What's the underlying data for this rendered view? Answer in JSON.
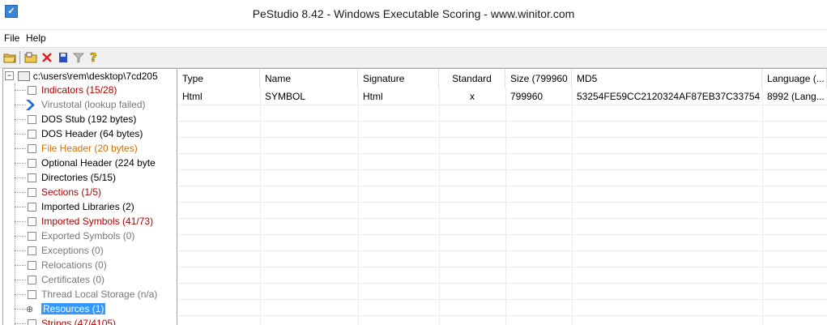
{
  "window": {
    "title": "PeStudio 8.42 - Windows Executable Scoring - www.winitor.com",
    "app_icon": "checkbox-app-icon"
  },
  "menu": [
    "File",
    "Help"
  ],
  "toolbar": {
    "buttons": [
      "open-folder-icon",
      "open-file-icon",
      "delete-icon",
      "save-icon",
      "filter-icon",
      "help-icon"
    ]
  },
  "tree": {
    "root": "c:\\users\\rem\\desktop\\7cd205",
    "items": [
      {
        "label": "Indicators (15/28)",
        "style": "red"
      },
      {
        "label": "Virustotal (lookup failed)",
        "style": "grey"
      },
      {
        "label": "DOS Stub (192 bytes)",
        "style": "normal"
      },
      {
        "label": "DOS Header (64 bytes)",
        "style": "normal"
      },
      {
        "label": "File Header (20 bytes)",
        "style": "orange"
      },
      {
        "label": "Optional Header (224 byte",
        "style": "normal"
      },
      {
        "label": "Directories (5/15)",
        "style": "normal"
      },
      {
        "label": "Sections (1/5)",
        "style": "red"
      },
      {
        "label": "Imported Libraries (2)",
        "style": "normal"
      },
      {
        "label": "Imported Symbols (41/73)",
        "style": "red"
      },
      {
        "label": "Exported Symbols (0)",
        "style": "grey"
      },
      {
        "label": "Exceptions (0)",
        "style": "grey"
      },
      {
        "label": "Relocations (0)",
        "style": "grey"
      },
      {
        "label": "Certificates (0)",
        "style": "grey"
      },
      {
        "label": "Thread Local Storage (n/a)",
        "style": "grey"
      },
      {
        "label": "Resources (1)",
        "style": "selected"
      },
      {
        "label": "Strings (47/4105)",
        "style": "red"
      }
    ]
  },
  "table": {
    "columns": [
      "Type",
      "Name",
      "Signature",
      "Standard",
      "Size (799960 ...",
      "MD5",
      "Language (..."
    ],
    "rows": [
      [
        "Html",
        "SYMBOL",
        "Html",
        "x",
        "799960",
        "53254FE59CC2120324AF87EB37C33754",
        "8992 (Lang..."
      ]
    ]
  }
}
